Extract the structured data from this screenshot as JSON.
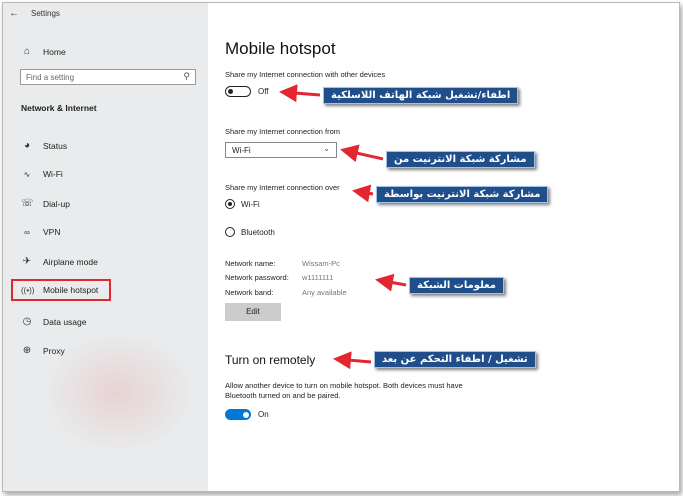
{
  "titlebar": {
    "back_icon": "back-arrow-icon",
    "title": "Settings"
  },
  "sidebar": {
    "home_label": "Home",
    "search_placeholder": "Find a setting",
    "section_title": "Network & Internet",
    "items": [
      {
        "label": "Status",
        "icon": "status-globe-icon"
      },
      {
        "label": "Wi-Fi",
        "icon": "wifi-icon"
      },
      {
        "label": "Dial-up",
        "icon": "dialup-icon"
      },
      {
        "label": "VPN",
        "icon": "vpn-icon"
      },
      {
        "label": "Airplane mode",
        "icon": "airplane-icon"
      },
      {
        "label": "Mobile hotspot",
        "icon": "hotspot-icon"
      },
      {
        "label": "Data usage",
        "icon": "data-usage-icon"
      },
      {
        "label": "Proxy",
        "icon": "proxy-globe-icon"
      }
    ]
  },
  "main": {
    "title": "Mobile hotspot",
    "share_label": "Share my Internet connection with other devices",
    "share_state": "Off",
    "share_from_label": "Share my Internet connection from",
    "share_from_value": "Wi-Fi",
    "share_over_label": "Share my Internet connection over",
    "share_over_options": [
      "Wi-Fi",
      "Bluetooth"
    ],
    "network": {
      "name_label": "Network name:",
      "name_value": "Wissam-Pc",
      "password_label": "Network password:",
      "password_value": "w1111111",
      "band_label": "Network band:",
      "band_value": "Any available"
    },
    "edit_label": "Edit",
    "remote_title": "Turn on remotely",
    "remote_desc": "Allow another device to turn on mobile hotspot. Both devices must have Bluetooth turned on and be paired.",
    "remote_state": "On"
  },
  "annotations": {
    "a1": "اطفاء/تشغيل شبكة الهاتف اللاسلكية",
    "a2": "مشاركة شبكة الانترنيت من",
    "a3": "مشاركة شبكة الانترنيت بواسطة",
    "a4": "معلومات الشبكة",
    "a5": "تشغيل / اطفاء التحكم عن بعد",
    "color": "#1f4e8a",
    "arrow_color": "#e3262f"
  },
  "colors": {
    "accent": "#0078d7",
    "highlight": "#e3262f",
    "sidebar_bg": "#e9ebec"
  }
}
